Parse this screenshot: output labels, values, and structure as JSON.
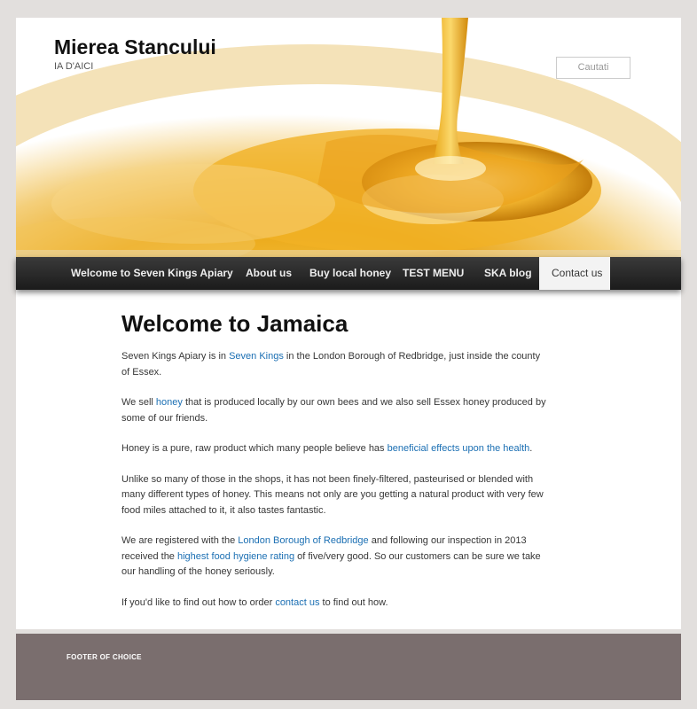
{
  "header": {
    "site_title": "Mierea Stancului",
    "site_description": "IA D'AICI",
    "search_placeholder": "Cautati"
  },
  "nav": {
    "items": [
      {
        "label": "Welcome to Seven Kings Apiary"
      },
      {
        "label": "About us"
      },
      {
        "label": "Buy local honey"
      },
      {
        "label": "TEST MENU"
      },
      {
        "label": "SKA blog"
      },
      {
        "label": "Contact us"
      }
    ]
  },
  "content": {
    "title": "Welcome to Jamaica",
    "p1": {
      "a": "Seven Kings Apiary is in ",
      "link": "Seven Kings",
      "b": " in the London Borough of Redbridge, just inside the county of Essex."
    },
    "p2": {
      "a": "We sell ",
      "link": "honey",
      "b": " that is produced locally by our own bees and we also sell Essex honey produced by some of our friends."
    },
    "p3": {
      "a": "Honey is a pure, raw product which many people believe has ",
      "link": "beneficial effects upon the health",
      "b": "."
    },
    "p4": {
      "text": "Unlike so many of those in the shops, it has not been finely-filtered, pasteurised or blended with many different types of honey. This means not only are you getting a natural product with very few food miles attached to it, it also tastes fantastic."
    },
    "p5": {
      "a": "We are registered with the ",
      "link1": "London Borough of Redbridge",
      "b": " and following our inspection in 2013 received the ",
      "link2": "highest food hygiene rating",
      "c": " of five/very good. So our customers can be sure we take our handling of the honey seriously."
    },
    "p6": {
      "a": "If you'd like to find out how to order ",
      "link": "contact us",
      "b": " to find out how."
    }
  },
  "footer": {
    "text": "FOOTER OF CHOICE"
  },
  "colors": {
    "background": "#e2dfdd",
    "link": "#1b6fb3",
    "nav_dark": "#222222",
    "footer": "#7a6e6e",
    "honey": "#e8a516"
  },
  "icons": {
    "header_image": "honey-pour-image"
  }
}
